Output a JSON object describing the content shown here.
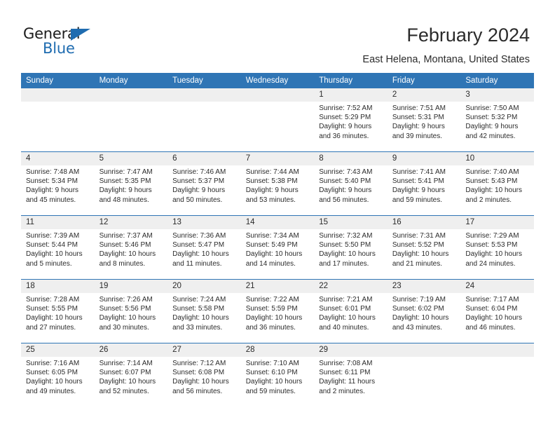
{
  "logo": {
    "word1": "General",
    "word2": "Blue",
    "triangle_color": "#1f6cb0",
    "text_color": "#1b1b1b"
  },
  "header": {
    "title": "February 2024",
    "subtitle": "East Helena, Montana, United States"
  },
  "colors": {
    "header_blue": "#2f75b5",
    "daynum_band": "#efefef",
    "text": "#2b2b2b",
    "page_background": "#ffffff"
  },
  "calendar": {
    "weekday_headers": [
      "Sunday",
      "Monday",
      "Tuesday",
      "Wednesday",
      "Thursday",
      "Friday",
      "Saturday"
    ],
    "weeks": [
      [
        {
          "day": "",
          "blank": true
        },
        {
          "day": "",
          "blank": true
        },
        {
          "day": "",
          "blank": true
        },
        {
          "day": "",
          "blank": true
        },
        {
          "day": "1",
          "sunrise": "Sunrise: 7:52 AM",
          "sunset": "Sunset: 5:29 PM",
          "daylight1": "Daylight: 9 hours",
          "daylight2": "and 36 minutes."
        },
        {
          "day": "2",
          "sunrise": "Sunrise: 7:51 AM",
          "sunset": "Sunset: 5:31 PM",
          "daylight1": "Daylight: 9 hours",
          "daylight2": "and 39 minutes."
        },
        {
          "day": "3",
          "sunrise": "Sunrise: 7:50 AM",
          "sunset": "Sunset: 5:32 PM",
          "daylight1": "Daylight: 9 hours",
          "daylight2": "and 42 minutes."
        }
      ],
      [
        {
          "day": "4",
          "sunrise": "Sunrise: 7:48 AM",
          "sunset": "Sunset: 5:34 PM",
          "daylight1": "Daylight: 9 hours",
          "daylight2": "and 45 minutes."
        },
        {
          "day": "5",
          "sunrise": "Sunrise: 7:47 AM",
          "sunset": "Sunset: 5:35 PM",
          "daylight1": "Daylight: 9 hours",
          "daylight2": "and 48 minutes."
        },
        {
          "day": "6",
          "sunrise": "Sunrise: 7:46 AM",
          "sunset": "Sunset: 5:37 PM",
          "daylight1": "Daylight: 9 hours",
          "daylight2": "and 50 minutes."
        },
        {
          "day": "7",
          "sunrise": "Sunrise: 7:44 AM",
          "sunset": "Sunset: 5:38 PM",
          "daylight1": "Daylight: 9 hours",
          "daylight2": "and 53 minutes."
        },
        {
          "day": "8",
          "sunrise": "Sunrise: 7:43 AM",
          "sunset": "Sunset: 5:40 PM",
          "daylight1": "Daylight: 9 hours",
          "daylight2": "and 56 minutes."
        },
        {
          "day": "9",
          "sunrise": "Sunrise: 7:41 AM",
          "sunset": "Sunset: 5:41 PM",
          "daylight1": "Daylight: 9 hours",
          "daylight2": "and 59 minutes."
        },
        {
          "day": "10",
          "sunrise": "Sunrise: 7:40 AM",
          "sunset": "Sunset: 5:43 PM",
          "daylight1": "Daylight: 10 hours",
          "daylight2": "and 2 minutes."
        }
      ],
      [
        {
          "day": "11",
          "sunrise": "Sunrise: 7:39 AM",
          "sunset": "Sunset: 5:44 PM",
          "daylight1": "Daylight: 10 hours",
          "daylight2": "and 5 minutes."
        },
        {
          "day": "12",
          "sunrise": "Sunrise: 7:37 AM",
          "sunset": "Sunset: 5:46 PM",
          "daylight1": "Daylight: 10 hours",
          "daylight2": "and 8 minutes."
        },
        {
          "day": "13",
          "sunrise": "Sunrise: 7:36 AM",
          "sunset": "Sunset: 5:47 PM",
          "daylight1": "Daylight: 10 hours",
          "daylight2": "and 11 minutes."
        },
        {
          "day": "14",
          "sunrise": "Sunrise: 7:34 AM",
          "sunset": "Sunset: 5:49 PM",
          "daylight1": "Daylight: 10 hours",
          "daylight2": "and 14 minutes."
        },
        {
          "day": "15",
          "sunrise": "Sunrise: 7:32 AM",
          "sunset": "Sunset: 5:50 PM",
          "daylight1": "Daylight: 10 hours",
          "daylight2": "and 17 minutes."
        },
        {
          "day": "16",
          "sunrise": "Sunrise: 7:31 AM",
          "sunset": "Sunset: 5:52 PM",
          "daylight1": "Daylight: 10 hours",
          "daylight2": "and 21 minutes."
        },
        {
          "day": "17",
          "sunrise": "Sunrise: 7:29 AM",
          "sunset": "Sunset: 5:53 PM",
          "daylight1": "Daylight: 10 hours",
          "daylight2": "and 24 minutes."
        }
      ],
      [
        {
          "day": "18",
          "sunrise": "Sunrise: 7:28 AM",
          "sunset": "Sunset: 5:55 PM",
          "daylight1": "Daylight: 10 hours",
          "daylight2": "and 27 minutes."
        },
        {
          "day": "19",
          "sunrise": "Sunrise: 7:26 AM",
          "sunset": "Sunset: 5:56 PM",
          "daylight1": "Daylight: 10 hours",
          "daylight2": "and 30 minutes."
        },
        {
          "day": "20",
          "sunrise": "Sunrise: 7:24 AM",
          "sunset": "Sunset: 5:58 PM",
          "daylight1": "Daylight: 10 hours",
          "daylight2": "and 33 minutes."
        },
        {
          "day": "21",
          "sunrise": "Sunrise: 7:22 AM",
          "sunset": "Sunset: 5:59 PM",
          "daylight1": "Daylight: 10 hours",
          "daylight2": "and 36 minutes."
        },
        {
          "day": "22",
          "sunrise": "Sunrise: 7:21 AM",
          "sunset": "Sunset: 6:01 PM",
          "daylight1": "Daylight: 10 hours",
          "daylight2": "and 40 minutes."
        },
        {
          "day": "23",
          "sunrise": "Sunrise: 7:19 AM",
          "sunset": "Sunset: 6:02 PM",
          "daylight1": "Daylight: 10 hours",
          "daylight2": "and 43 minutes."
        },
        {
          "day": "24",
          "sunrise": "Sunrise: 7:17 AM",
          "sunset": "Sunset: 6:04 PM",
          "daylight1": "Daylight: 10 hours",
          "daylight2": "and 46 minutes."
        }
      ],
      [
        {
          "day": "25",
          "sunrise": "Sunrise: 7:16 AM",
          "sunset": "Sunset: 6:05 PM",
          "daylight1": "Daylight: 10 hours",
          "daylight2": "and 49 minutes."
        },
        {
          "day": "26",
          "sunrise": "Sunrise: 7:14 AM",
          "sunset": "Sunset: 6:07 PM",
          "daylight1": "Daylight: 10 hours",
          "daylight2": "and 52 minutes."
        },
        {
          "day": "27",
          "sunrise": "Sunrise: 7:12 AM",
          "sunset": "Sunset: 6:08 PM",
          "daylight1": "Daylight: 10 hours",
          "daylight2": "and 56 minutes."
        },
        {
          "day": "28",
          "sunrise": "Sunrise: 7:10 AM",
          "sunset": "Sunset: 6:10 PM",
          "daylight1": "Daylight: 10 hours",
          "daylight2": "and 59 minutes."
        },
        {
          "day": "29",
          "sunrise": "Sunrise: 7:08 AM",
          "sunset": "Sunset: 6:11 PM",
          "daylight1": "Daylight: 11 hours",
          "daylight2": "and 2 minutes."
        },
        {
          "day": "",
          "blank": true
        },
        {
          "day": "",
          "blank": true
        }
      ]
    ]
  }
}
